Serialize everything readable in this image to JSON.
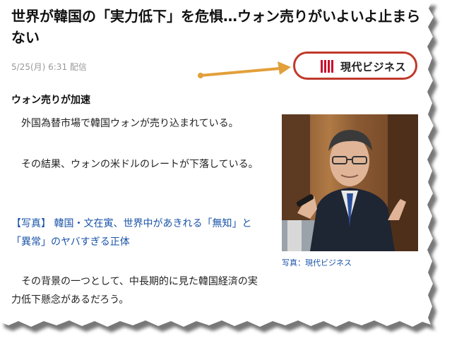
{
  "article": {
    "title": "世界が韓国の「実力低下」を危惧…ウォン売りがいよいよ止まらない",
    "dateline": "5/25(月) 6:31 配信",
    "subheading": "ウォン売りが加速",
    "paragraphs": [
      "　外国為替市場で韓国ウォンが売り込まれている。",
      "　その結果、ウォンの米ドルのレートが下落している。",
      "【写真】 韓国・文在寅、世界中があきれる「無知」と「異常」のヤバすぎる正体",
      "　その背景の一つとして、中長期的に見た韓国経済の実力低下懸念があるだろう。"
    ]
  },
  "source_badge": {
    "name": "現代ビジネス"
  },
  "photo": {
    "caption": "写真：現代ビジネス"
  },
  "colors": {
    "badge_border": "#c0392b",
    "arrow": "#e2a03a",
    "link": "#1a53a8"
  }
}
